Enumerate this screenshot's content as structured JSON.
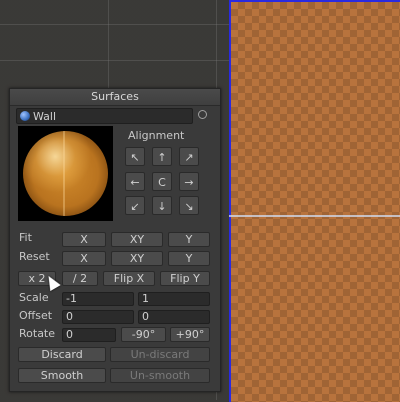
{
  "panel": {
    "title": "Surfaces",
    "material": "Wall",
    "alignment": {
      "title": "Alignment",
      "buttons": [
        "↖",
        "↑",
        "↗",
        "←",
        "C",
        "→",
        "↙",
        "↓",
        "↘"
      ]
    },
    "fit": {
      "label": "Fit",
      "x": "X",
      "xy": "XY",
      "y": "Y"
    },
    "reset": {
      "label": "Reset",
      "x": "X",
      "xy": "XY",
      "y": "Y"
    },
    "scale_buttons": {
      "times2": "x 2",
      "div2": "/ 2",
      "flipx": "Flip X",
      "flipy": "Flip Y"
    },
    "scale": {
      "label": "Scale",
      "x": "-1",
      "y": "1"
    },
    "offset": {
      "label": "Offset",
      "x": "0",
      "y": "0"
    },
    "rotate": {
      "label": "Rotate",
      "value": "0",
      "minus90": "-90°",
      "plus90": "+90°"
    },
    "discard": "Discard",
    "undiscard": "Un-discard",
    "smooth": "Smooth",
    "unsmooth": "Un-smooth"
  }
}
